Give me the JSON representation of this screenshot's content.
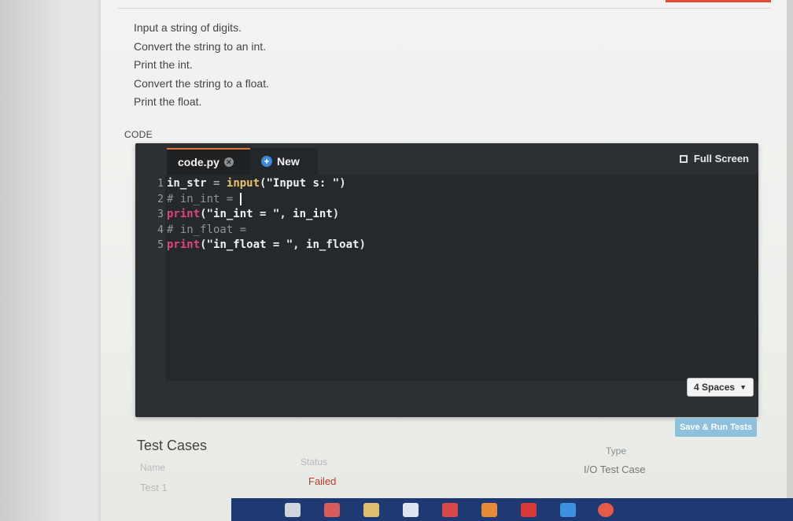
{
  "instructions": [
    "Input a string of digits.",
    "Convert the string to an int.",
    "Print the int.",
    "Convert the string to a float.",
    "Print the float."
  ],
  "code_section_label": "CODE",
  "editor": {
    "tabs": [
      {
        "label": "code.py",
        "icon": "close-icon"
      },
      {
        "label": "New",
        "icon": "plus-circle-icon"
      }
    ],
    "fullscreen_label": "Full Screen",
    "line_numbers": [
      "1",
      "2",
      "3",
      "4",
      "5"
    ],
    "code_lines": [
      "in_str = input(\"Input s: \")",
      "# in_int = ",
      "print(\"in_int = \", in_int)",
      "# in_float = ",
      "print(\"in_float = \", in_float)"
    ],
    "indent_option": "4 Spaces"
  },
  "save_button_label": "Save & Run Tests",
  "test_cases": {
    "title": "Test Cases",
    "columns": {
      "name": "Name",
      "status": "Status",
      "type": "Type"
    },
    "rows": [
      {
        "name": "Test 1",
        "status": "Failed",
        "type": "I/O Test Case"
      }
    ]
  },
  "colors": {
    "tab_accent": "#e3733a",
    "editor_bg": "#26292c",
    "keyword_call": "#e0457a",
    "function_call": "#e8c36a",
    "failed_status": "#c0392b",
    "save_button": "#8fc0dc",
    "taskbar": "#1f3a72"
  },
  "taskbar": {
    "icons": [
      "settings-icon",
      "store-icon",
      "folder-icon",
      "dropbox-icon",
      "app-icon",
      "firefox-icon",
      "ccleaner-icon",
      "edge-icon",
      "chrome-icon"
    ]
  }
}
